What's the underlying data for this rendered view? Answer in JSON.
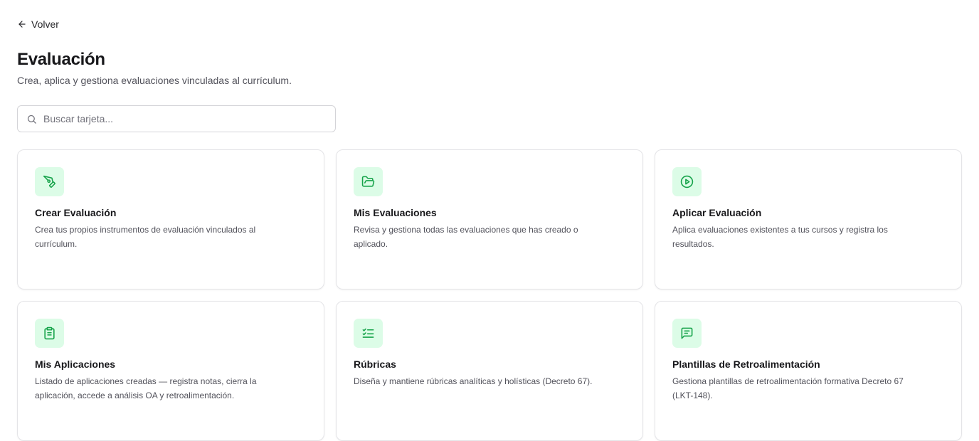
{
  "nav": {
    "back_label": "Volver"
  },
  "header": {
    "title": "Evaluación",
    "subtitle": "Crea, aplica y gestiona evaluaciones vinculadas al currículum."
  },
  "search": {
    "placeholder": "Buscar tarjeta...",
    "value": ""
  },
  "theme": {
    "accent": "#16a34a",
    "icon_bg": "#dcfce7"
  },
  "cards": [
    {
      "icon": "pen-tool-icon",
      "title": "Crear Evaluación",
      "description": "Crea tus propios instrumentos de evaluación vinculados al currículum."
    },
    {
      "icon": "folder-open-icon",
      "title": "Mis Evaluaciones",
      "description": "Revisa y gestiona todas las evaluaciones que has creado o aplicado."
    },
    {
      "icon": "play-circle-icon",
      "title": "Aplicar Evaluación",
      "description": "Aplica evaluaciones existentes a tus cursos y registra los resultados."
    },
    {
      "icon": "clipboard-list-icon",
      "title": "Mis Aplicaciones",
      "description": "Listado de aplicaciones creadas — registra notas, cierra la aplicación, accede a análisis OA y retroalimentación."
    },
    {
      "icon": "list-checks-icon",
      "title": "Rúbricas",
      "description": "Diseña y mantiene rúbricas analíticas y holísticas (Decreto 67)."
    },
    {
      "icon": "message-square-text-icon",
      "title": "Plantillas de Retroalimentación",
      "description": "Gestiona plantillas de retroalimentación formativa Decreto 67 (LKT-148)."
    }
  ]
}
